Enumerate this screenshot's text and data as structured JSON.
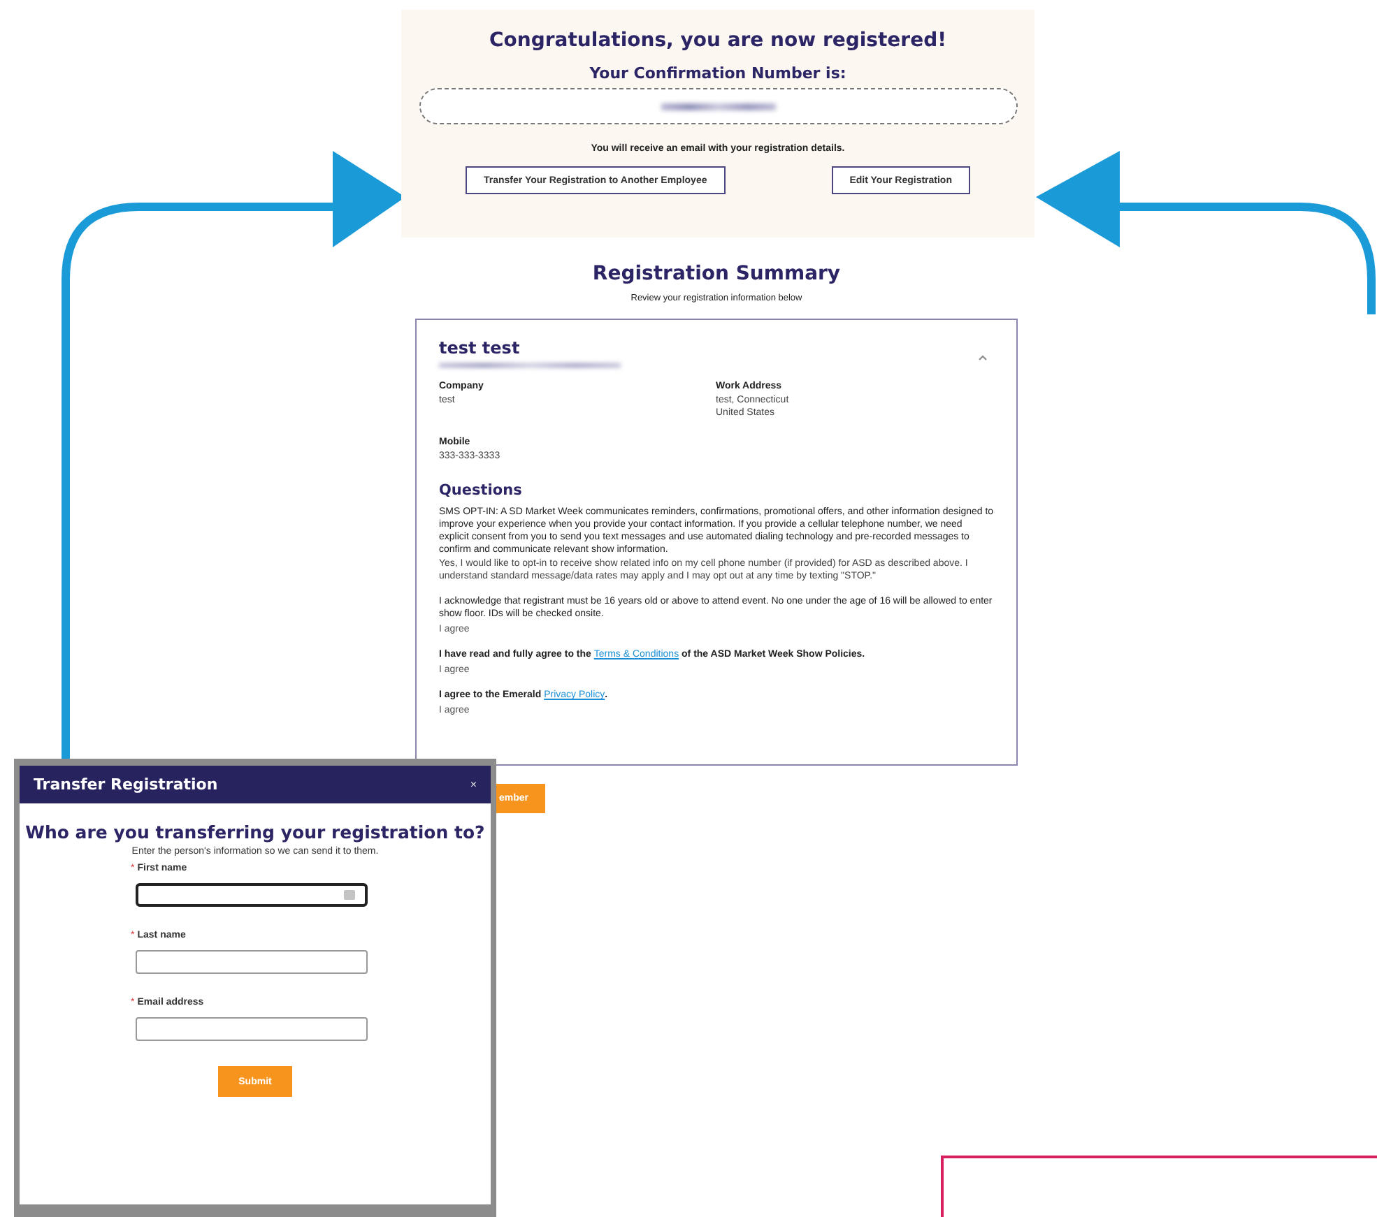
{
  "confirmation_panel": {
    "title": "Congratulations, you are now registered!",
    "number_label": "Your Confirmation Number is:",
    "notice": "You will receive an email with your registration details.",
    "buttons": [
      {
        "label": "Transfer Your Registration to Another Employee"
      },
      {
        "label": "Edit Your Registration"
      }
    ]
  },
  "summary": {
    "title": "Registration Summary",
    "subtitle": "Review your registration information below",
    "attendee": {
      "name": "test test",
      "expanded": true
    },
    "fields": [
      {
        "label": "Company",
        "lines": [
          "test"
        ]
      },
      {
        "label": "Work Address",
        "lines": [
          "test, Connecticut",
          "United States"
        ]
      },
      {
        "label": "Mobile",
        "lines": [
          "333-333-3333"
        ]
      }
    ],
    "questions_title": "Questions",
    "questions": [
      {
        "emphasis": false,
        "text": "SMS OPT-IN: A SD Market Week communicates reminders, confirmations, promotional offers, and other information designed to improve your experience when you provide your contact information. If you provide a cellular telephone number, we need explicit consent from you to send you text messages and use automated dialing technology and pre-recorded messages to confirm and communicate relevant show information.",
        "answer": "Yes, I would like to opt-in to receive show related info on my cell phone number (if provided) for ASD as described above. I understand standard message/data rates may apply and I may opt out at any time by texting \"STOP.\""
      },
      {
        "emphasis": false,
        "text": "I acknowledge that registrant must be 16 years old or above to attend event. No one under the age of 16 will be allowed to enter show floor. IDs will be checked onsite.",
        "answer": "I agree"
      },
      {
        "emphasis": true,
        "text": "I have read and fully agree to the ",
        "link": "Terms & Conditions",
        "after": " of the ASD Market Week Show Policies.",
        "answer": "I agree"
      },
      {
        "emphasis": true,
        "text": "I agree to the Emerald ",
        "link": "Privacy Policy",
        "after": ".",
        "answer": "I agree"
      }
    ]
  },
  "background_button": {
    "label": "ember"
  },
  "modal": {
    "title": "Transfer Registration",
    "close": "×",
    "heading": "Who are you transferring your registration to?",
    "subtitle": "Enter the person's information so we can send it to them.",
    "fields": [
      {
        "mark": "*",
        "label": "First name",
        "focused": true
      },
      {
        "mark": "*",
        "label": "Last name",
        "focused": false
      },
      {
        "mark": "*",
        "label": "Email address",
        "focused": false
      }
    ],
    "submit": "Submit"
  }
}
